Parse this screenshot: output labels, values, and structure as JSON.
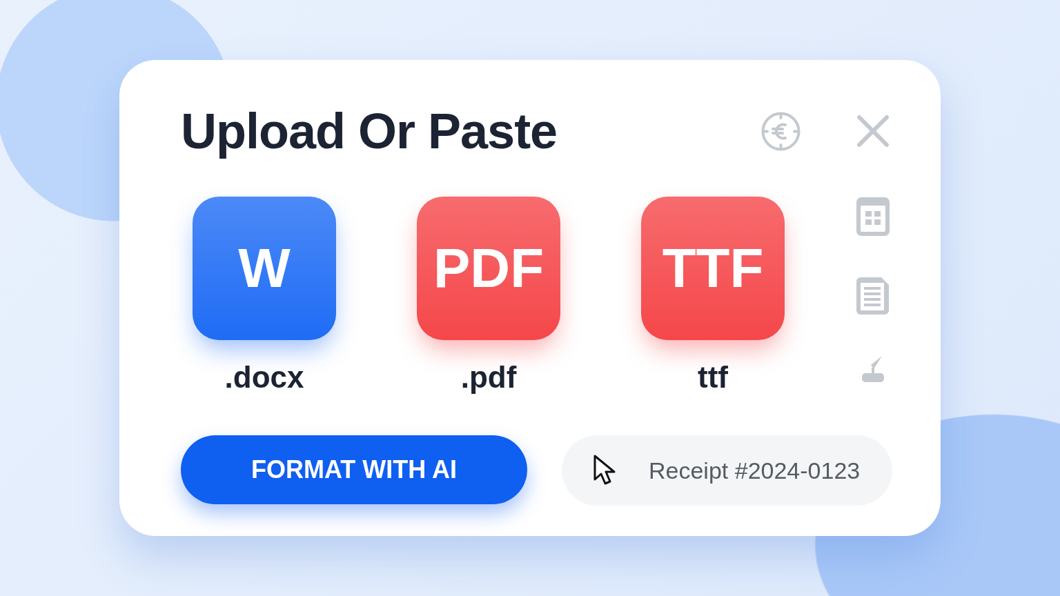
{
  "dialog": {
    "title": "Upload Or Paste",
    "formats": [
      {
        "badge": "W",
        "extension": ".docx",
        "color": "#1f6cf5"
      },
      {
        "badge": "PDF",
        "extension": ".pdf",
        "color": "#f5474a"
      },
      {
        "badge": "TTF",
        "extension": "ttf",
        "color": "#f5474a"
      }
    ],
    "primary_button": "FORMAT WITH AI",
    "paste_field": {
      "value": "Receipt #2024-0123"
    }
  }
}
